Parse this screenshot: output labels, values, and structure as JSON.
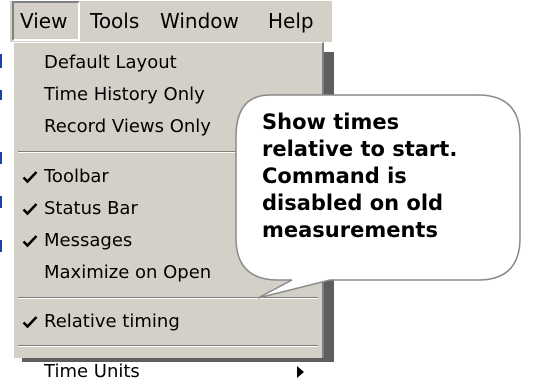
{
  "menubar": {
    "items": [
      {
        "label": "View",
        "active": true
      },
      {
        "label": "Tools",
        "active": false
      },
      {
        "label": "Window",
        "active": false
      },
      {
        "label": "Help",
        "active": false
      }
    ]
  },
  "view_menu": {
    "items": [
      {
        "label": "Default Layout",
        "checked": false
      },
      {
        "label": "Time History Only",
        "checked": false
      },
      {
        "label": "Record Views Only",
        "checked": false
      },
      {
        "label": "Toolbar",
        "checked": true
      },
      {
        "label": "Status Bar",
        "checked": true
      },
      {
        "label": "Messages",
        "checked": true
      },
      {
        "label": "Maximize on Open",
        "checked": false
      },
      {
        "label": "Relative timing",
        "checked": true
      },
      {
        "label": "Time Units",
        "checked": false,
        "submenu": true
      }
    ]
  },
  "callout": {
    "lines": [
      "Show times",
      "relative to start.",
      "Command is",
      "disabled on old",
      "measurements"
    ]
  },
  "colors": {
    "menu_face": "#d4d0c8",
    "shadow": "#5e5e5e",
    "highlight": "#ffffff",
    "edge": "#808080"
  }
}
